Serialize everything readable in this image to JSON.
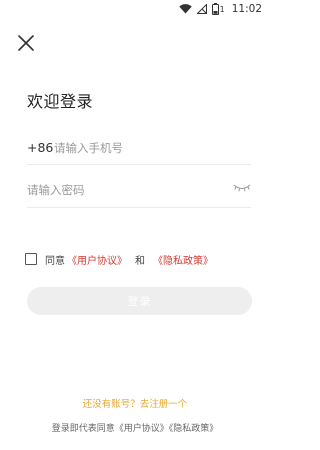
{
  "status_bar": {
    "time": "11:02",
    "battery_level": "1",
    "wifi_icon": "wifi-icon",
    "signal_icon": "no-signal-icon",
    "battery_icon": "battery-icon"
  },
  "header": {
    "close_icon": "close-icon",
    "title": "欢迎登录"
  },
  "form": {
    "country_code": "+86",
    "phone_placeholder": "请输入手机号",
    "phone_value": "",
    "password_placeholder": "请输入密码",
    "password_value": "",
    "eye_icon": "eye-closed-icon"
  },
  "agreement": {
    "checked": false,
    "prefix": "同意",
    "user_agreement": "《用户协议》",
    "and": "和",
    "privacy_policy": "《隐私政策》"
  },
  "login_button": {
    "label": "登录",
    "disabled_color": "#eeeeee"
  },
  "register": {
    "label": "还没有账号？去注册一个",
    "color": "#e6a82f"
  },
  "footer": {
    "prefix": "登录即代表同意",
    "user_agreement": "《用户协议》",
    "privacy_policy": "《隐私政策》"
  },
  "colors": {
    "link_red": "#d23b35",
    "divider": "#ececec"
  }
}
